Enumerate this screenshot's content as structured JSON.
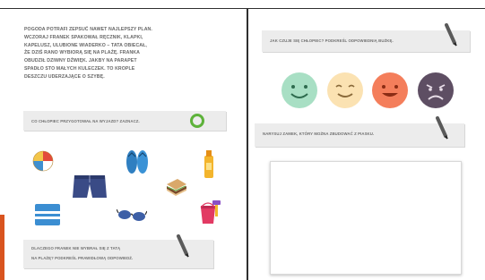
{
  "story": {
    "lines": [
      "POGODA POTRAFI ZEPSUĆ NAWET NAJLEPSZY PLAN.",
      "WCZORAJ FRANEK SPAKOWAŁ RĘCZNIK, KLAPKI,",
      "KAPELUSZ, ULUBIONE WIADERKO – TATA OBIECAŁ,",
      "ŻE DZIŚ RANO WYBIORĄ SIĘ NA PLAŻĘ. FRANKA",
      "OBUDZIŁ DZIWNY DŹWIĘK. JAKBY NA PARAPET",
      "SPADŁO STO MAŁYCH KULECZEK. TO KROPLE",
      "DESZCZU UDERZAJĄCE O SZYBĘ."
    ]
  },
  "tasks": {
    "circle_items": "CO CHŁOPIEC PRZYGOTOWAŁ NA WYJAZD? ZAZNACZ.",
    "why_not_beach_line1": "DLACZEGO FRANEK NIE WYBRAŁ SIĘ Z TATĄ",
    "why_not_beach_line2": "NA PLAŻĘ? PODKREŚL PRAWIDŁOWĄ ODPOWIEDŹ.",
    "feelings": "JAK CZUJE SIĘ CHŁOPIEC? PODKREŚL ODPOWIEDNIĄ BUŹKĘ.",
    "draw_castle": "NARYSUJ ZAMEK, KTÓRY MOŻNA ZBUDOWAĆ Z PIASKU."
  },
  "colors": {
    "accent_orange": "#d9541f",
    "circle_mark": "#5db23a",
    "faces": [
      "#a8dfc4",
      "#fbe2b2",
      "#f47e5b",
      "#5e4e63"
    ]
  },
  "icons": [
    "beach-ball-icon",
    "swim-shorts-icon",
    "flip-flops-icon",
    "sunscreen-bottle-icon",
    "sandwich-icon",
    "towel-icon",
    "sunglasses-icon",
    "sand-bucket-icon",
    "pencil-icon"
  ]
}
